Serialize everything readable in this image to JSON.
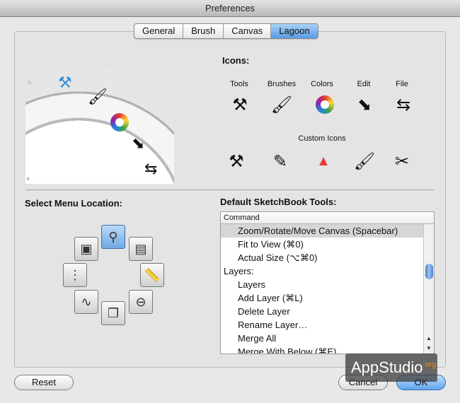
{
  "window": {
    "title": "Preferences"
  },
  "tabs": [
    {
      "label": "General"
    },
    {
      "label": "Brush"
    },
    {
      "label": "Canvas"
    },
    {
      "label": "Lagoon",
      "active": true
    }
  ],
  "icons_section": {
    "title": "Icons:",
    "labels": [
      "Tools",
      "Brushes",
      "Colors",
      "Edit",
      "File"
    ],
    "custom_label": "Custom Icons"
  },
  "menu_location": {
    "title": "Select Menu Location:"
  },
  "tools_section": {
    "title": "Default SketchBook Tools:",
    "header": "Command",
    "rows": [
      "Zoom/Rotate/Move Canvas (Spacebar)",
      "Fit to View (⌘0)",
      "Actual Size (⌥⌘0)",
      "Layers:",
      "Layers",
      "Add Layer (⌘L)",
      "Delete Layer",
      "Rename Layer…",
      "Merge All",
      "Merge With Below (⌘E)"
    ]
  },
  "buttons": {
    "reset": "Reset",
    "cancel": "Cancel",
    "ok": "OK"
  },
  "watermark": {
    "text": "AppStudio",
    "suffix": ".org"
  },
  "colors": {
    "accent": "#5a9be6",
    "selection": "#d6d6d6"
  }
}
